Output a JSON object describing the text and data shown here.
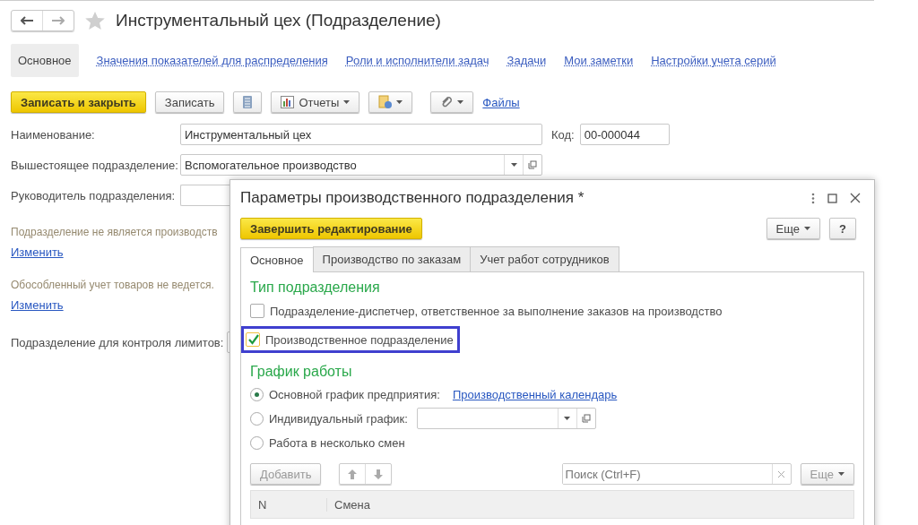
{
  "form": {
    "title": "Инструментальный цех (Подразделение)",
    "tabs": [
      {
        "label": "Основное",
        "selected": true
      },
      {
        "label": "Значения показателей для распределения",
        "selected": false
      },
      {
        "label": "Роли и исполнители задач",
        "selected": false
      },
      {
        "label": "Задачи",
        "selected": false
      },
      {
        "label": "Мои заметки",
        "selected": false
      },
      {
        "label": "Настройки учета серий",
        "selected": false
      }
    ],
    "toolbar": {
      "save_close": "Записать и закрыть",
      "save": "Записать",
      "reports": "Отчеты",
      "files": "Файлы"
    },
    "name": {
      "label": "Наименование:",
      "value": "Инструментальный цех"
    },
    "code": {
      "label": "Код:",
      "value": "00-000044"
    },
    "parent": {
      "label": "Вышестоящее подразделение:",
      "value": "Вспомогательное производство"
    },
    "head": {
      "label": "Руководитель подразделения:"
    },
    "notes": [
      {
        "text": "Подразделение не является производств",
        "link": "Изменить"
      },
      {
        "text": "Обособленный учет товаров не ведется.",
        "link": "Изменить"
      }
    ],
    "limits": {
      "label": "Подразделение для контроля лимитов:"
    }
  },
  "dialog": {
    "title": "Параметры производственного подразделения *",
    "finish": "Завершить редактирование",
    "more": "Еще",
    "help": "?",
    "tabs": [
      {
        "label": "Основное",
        "selected": true
      },
      {
        "label": "Производство по заказам",
        "selected": false
      },
      {
        "label": "Учет работ сотрудников",
        "selected": false
      }
    ],
    "type_section": "Тип подразделения",
    "checks": [
      {
        "label": "Подразделение-диспетчер, ответственное за выполнение заказов на производство",
        "checked": false,
        "highlighted": false
      },
      {
        "label": "Производственное подразделение",
        "checked": true,
        "highlighted": true
      }
    ],
    "schedule_section": "График работы",
    "radios": [
      {
        "label": "Основной график предприятия:",
        "selected": true,
        "kind": "link",
        "link": "Производственный календарь"
      },
      {
        "label": "Индивидуальный график:",
        "selected": false,
        "kind": "select"
      },
      {
        "label": "Работа в несколько смен",
        "selected": false,
        "kind": "plain"
      }
    ],
    "add": {
      "label": "Добавить",
      "disabled": true
    },
    "search": {
      "placeholder": "Поиск (Ctrl+F)"
    },
    "more2": "Еще",
    "columns": [
      "N",
      "Смена"
    ]
  }
}
